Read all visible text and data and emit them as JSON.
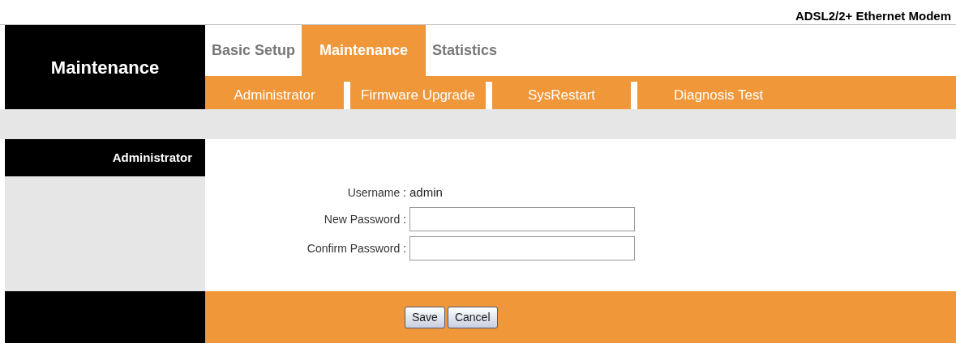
{
  "header": {
    "product": "ADSL2/2+ Ethernet Modem"
  },
  "section_title": "Maintenance",
  "tabs": [
    {
      "label": "Basic Setup",
      "selected": false
    },
    {
      "label": "Maintenance",
      "selected": true
    },
    {
      "label": "Statistics",
      "selected": false
    }
  ],
  "subnav": [
    "Administrator",
    "Firmware Upgrade",
    "SysRestart",
    "Diagnosis Test"
  ],
  "sidebar": {
    "title": "Administrator"
  },
  "form": {
    "username_label": "Username :",
    "username_value": "admin",
    "fields": [
      {
        "label": "New Password :"
      },
      {
        "label": "Confirm Password :"
      }
    ]
  },
  "buttons": [
    "Save",
    "Cancel"
  ]
}
